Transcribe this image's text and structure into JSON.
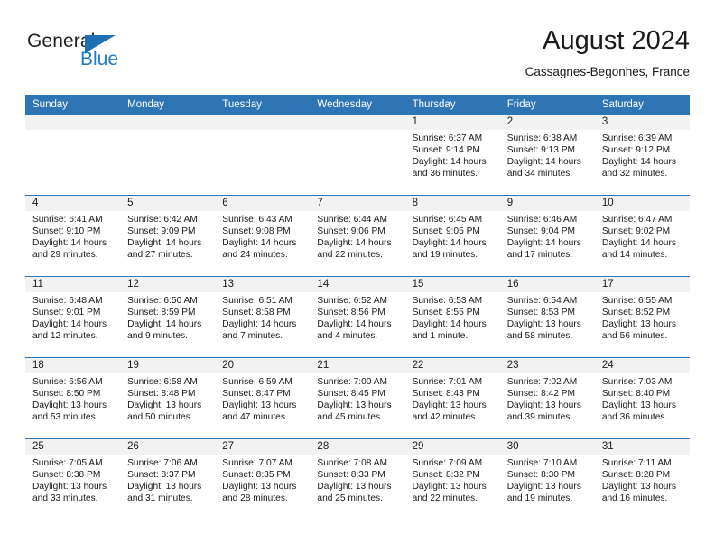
{
  "brand": {
    "name_top": "General",
    "name_bottom": "Blue",
    "flag_icon": "blue-triangle-flag-icon",
    "colors": {
      "dark_text": "#231f20",
      "blue_text": "#1f7ac4",
      "flag_blue": "#1f6fb5"
    }
  },
  "header": {
    "title": "August 2024",
    "subtitle": "Cassagnes-Begonhes, France"
  },
  "theme": {
    "header_row_bg": "#2e75b6",
    "header_row_text": "#ffffff",
    "date_band_bg": "#f2f2f2",
    "cell_bg": "#ffffff",
    "row_divider": "#2e75b6"
  },
  "weekday_headers": [
    "Sunday",
    "Monday",
    "Tuesday",
    "Wednesday",
    "Thursday",
    "Friday",
    "Saturday"
  ],
  "weeks": [
    [
      {
        "empty": true,
        "date": "",
        "sunrise": "",
        "sunset": "",
        "daylight": ""
      },
      {
        "empty": true,
        "date": "",
        "sunrise": "",
        "sunset": "",
        "daylight": ""
      },
      {
        "empty": true,
        "date": "",
        "sunrise": "",
        "sunset": "",
        "daylight": ""
      },
      {
        "empty": true,
        "date": "",
        "sunrise": "",
        "sunset": "",
        "daylight": ""
      },
      {
        "empty": false,
        "date": "1",
        "sunrise": "Sunrise: 6:37 AM",
        "sunset": "Sunset: 9:14 PM",
        "daylight": "Daylight: 14 hours and 36 minutes."
      },
      {
        "empty": false,
        "date": "2",
        "sunrise": "Sunrise: 6:38 AM",
        "sunset": "Sunset: 9:13 PM",
        "daylight": "Daylight: 14 hours and 34 minutes."
      },
      {
        "empty": false,
        "date": "3",
        "sunrise": "Sunrise: 6:39 AM",
        "sunset": "Sunset: 9:12 PM",
        "daylight": "Daylight: 14 hours and 32 minutes."
      }
    ],
    [
      {
        "empty": false,
        "date": "4",
        "sunrise": "Sunrise: 6:41 AM",
        "sunset": "Sunset: 9:10 PM",
        "daylight": "Daylight: 14 hours and 29 minutes."
      },
      {
        "empty": false,
        "date": "5",
        "sunrise": "Sunrise: 6:42 AM",
        "sunset": "Sunset: 9:09 PM",
        "daylight": "Daylight: 14 hours and 27 minutes."
      },
      {
        "empty": false,
        "date": "6",
        "sunrise": "Sunrise: 6:43 AM",
        "sunset": "Sunset: 9:08 PM",
        "daylight": "Daylight: 14 hours and 24 minutes."
      },
      {
        "empty": false,
        "date": "7",
        "sunrise": "Sunrise: 6:44 AM",
        "sunset": "Sunset: 9:06 PM",
        "daylight": "Daylight: 14 hours and 22 minutes."
      },
      {
        "empty": false,
        "date": "8",
        "sunrise": "Sunrise: 6:45 AM",
        "sunset": "Sunset: 9:05 PM",
        "daylight": "Daylight: 14 hours and 19 minutes."
      },
      {
        "empty": false,
        "date": "9",
        "sunrise": "Sunrise: 6:46 AM",
        "sunset": "Sunset: 9:04 PM",
        "daylight": "Daylight: 14 hours and 17 minutes."
      },
      {
        "empty": false,
        "date": "10",
        "sunrise": "Sunrise: 6:47 AM",
        "sunset": "Sunset: 9:02 PM",
        "daylight": "Daylight: 14 hours and 14 minutes."
      }
    ],
    [
      {
        "empty": false,
        "date": "11",
        "sunrise": "Sunrise: 6:48 AM",
        "sunset": "Sunset: 9:01 PM",
        "daylight": "Daylight: 14 hours and 12 minutes."
      },
      {
        "empty": false,
        "date": "12",
        "sunrise": "Sunrise: 6:50 AM",
        "sunset": "Sunset: 8:59 PM",
        "daylight": "Daylight: 14 hours and 9 minutes."
      },
      {
        "empty": false,
        "date": "13",
        "sunrise": "Sunrise: 6:51 AM",
        "sunset": "Sunset: 8:58 PM",
        "daylight": "Daylight: 14 hours and 7 minutes."
      },
      {
        "empty": false,
        "date": "14",
        "sunrise": "Sunrise: 6:52 AM",
        "sunset": "Sunset: 8:56 PM",
        "daylight": "Daylight: 14 hours and 4 minutes."
      },
      {
        "empty": false,
        "date": "15",
        "sunrise": "Sunrise: 6:53 AM",
        "sunset": "Sunset: 8:55 PM",
        "daylight": "Daylight: 14 hours and 1 minute."
      },
      {
        "empty": false,
        "date": "16",
        "sunrise": "Sunrise: 6:54 AM",
        "sunset": "Sunset: 8:53 PM",
        "daylight": "Daylight: 13 hours and 58 minutes."
      },
      {
        "empty": false,
        "date": "17",
        "sunrise": "Sunrise: 6:55 AM",
        "sunset": "Sunset: 8:52 PM",
        "daylight": "Daylight: 13 hours and 56 minutes."
      }
    ],
    [
      {
        "empty": false,
        "date": "18",
        "sunrise": "Sunrise: 6:56 AM",
        "sunset": "Sunset: 8:50 PM",
        "daylight": "Daylight: 13 hours and 53 minutes."
      },
      {
        "empty": false,
        "date": "19",
        "sunrise": "Sunrise: 6:58 AM",
        "sunset": "Sunset: 8:48 PM",
        "daylight": "Daylight: 13 hours and 50 minutes."
      },
      {
        "empty": false,
        "date": "20",
        "sunrise": "Sunrise: 6:59 AM",
        "sunset": "Sunset: 8:47 PM",
        "daylight": "Daylight: 13 hours and 47 minutes."
      },
      {
        "empty": false,
        "date": "21",
        "sunrise": "Sunrise: 7:00 AM",
        "sunset": "Sunset: 8:45 PM",
        "daylight": "Daylight: 13 hours and 45 minutes."
      },
      {
        "empty": false,
        "date": "22",
        "sunrise": "Sunrise: 7:01 AM",
        "sunset": "Sunset: 8:43 PM",
        "daylight": "Daylight: 13 hours and 42 minutes."
      },
      {
        "empty": false,
        "date": "23",
        "sunrise": "Sunrise: 7:02 AM",
        "sunset": "Sunset: 8:42 PM",
        "daylight": "Daylight: 13 hours and 39 minutes."
      },
      {
        "empty": false,
        "date": "24",
        "sunrise": "Sunrise: 7:03 AM",
        "sunset": "Sunset: 8:40 PM",
        "daylight": "Daylight: 13 hours and 36 minutes."
      }
    ],
    [
      {
        "empty": false,
        "date": "25",
        "sunrise": "Sunrise: 7:05 AM",
        "sunset": "Sunset: 8:38 PM",
        "daylight": "Daylight: 13 hours and 33 minutes."
      },
      {
        "empty": false,
        "date": "26",
        "sunrise": "Sunrise: 7:06 AM",
        "sunset": "Sunset: 8:37 PM",
        "daylight": "Daylight: 13 hours and 31 minutes."
      },
      {
        "empty": false,
        "date": "27",
        "sunrise": "Sunrise: 7:07 AM",
        "sunset": "Sunset: 8:35 PM",
        "daylight": "Daylight: 13 hours and 28 minutes."
      },
      {
        "empty": false,
        "date": "28",
        "sunrise": "Sunrise: 7:08 AM",
        "sunset": "Sunset: 8:33 PM",
        "daylight": "Daylight: 13 hours and 25 minutes."
      },
      {
        "empty": false,
        "date": "29",
        "sunrise": "Sunrise: 7:09 AM",
        "sunset": "Sunset: 8:32 PM",
        "daylight": "Daylight: 13 hours and 22 minutes."
      },
      {
        "empty": false,
        "date": "30",
        "sunrise": "Sunrise: 7:10 AM",
        "sunset": "Sunset: 8:30 PM",
        "daylight": "Daylight: 13 hours and 19 minutes."
      },
      {
        "empty": false,
        "date": "31",
        "sunrise": "Sunrise: 7:11 AM",
        "sunset": "Sunset: 8:28 PM",
        "daylight": "Daylight: 13 hours and 16 minutes."
      }
    ]
  ]
}
